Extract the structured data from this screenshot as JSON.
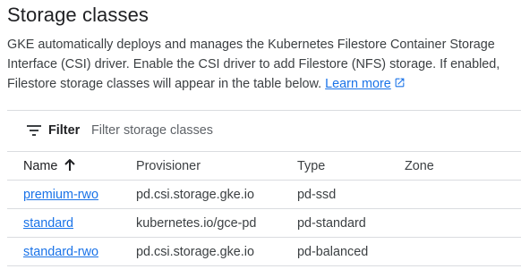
{
  "section": {
    "title": "Storage classes",
    "description": "GKE automatically deploys and manages the Kubernetes Filestore Container Storage Interface (CSI) driver. Enable the CSI driver to add Filestore (NFS) storage. If enabled, Filestore storage classes will appear in the table below.",
    "learn_more": "Learn more"
  },
  "filter": {
    "label": "Filter",
    "placeholder": "Filter storage classes"
  },
  "table": {
    "columns": [
      "Name",
      "Provisioner",
      "Type",
      "Zone"
    ],
    "sort": {
      "column": "Name",
      "direction": "ascending"
    },
    "rows": [
      {
        "name": "premium-rwo",
        "provisioner": "pd.csi.storage.gke.io",
        "type": "pd-ssd",
        "zone": ""
      },
      {
        "name": "standard",
        "provisioner": "kubernetes.io/gce-pd",
        "type": "pd-standard",
        "zone": ""
      },
      {
        "name": "standard-rwo",
        "provisioner": "pd.csi.storage.gke.io",
        "type": "pd-balanced",
        "zone": ""
      }
    ]
  },
  "colors": {
    "link": "#1a73e8",
    "text": "#202124",
    "secondary_text": "#3c4043",
    "divider": "#dadce0"
  },
  "icons": {
    "filter": "filter-list-icon",
    "external": "open-in-new-icon",
    "sort": "arrow-upward-icon"
  }
}
